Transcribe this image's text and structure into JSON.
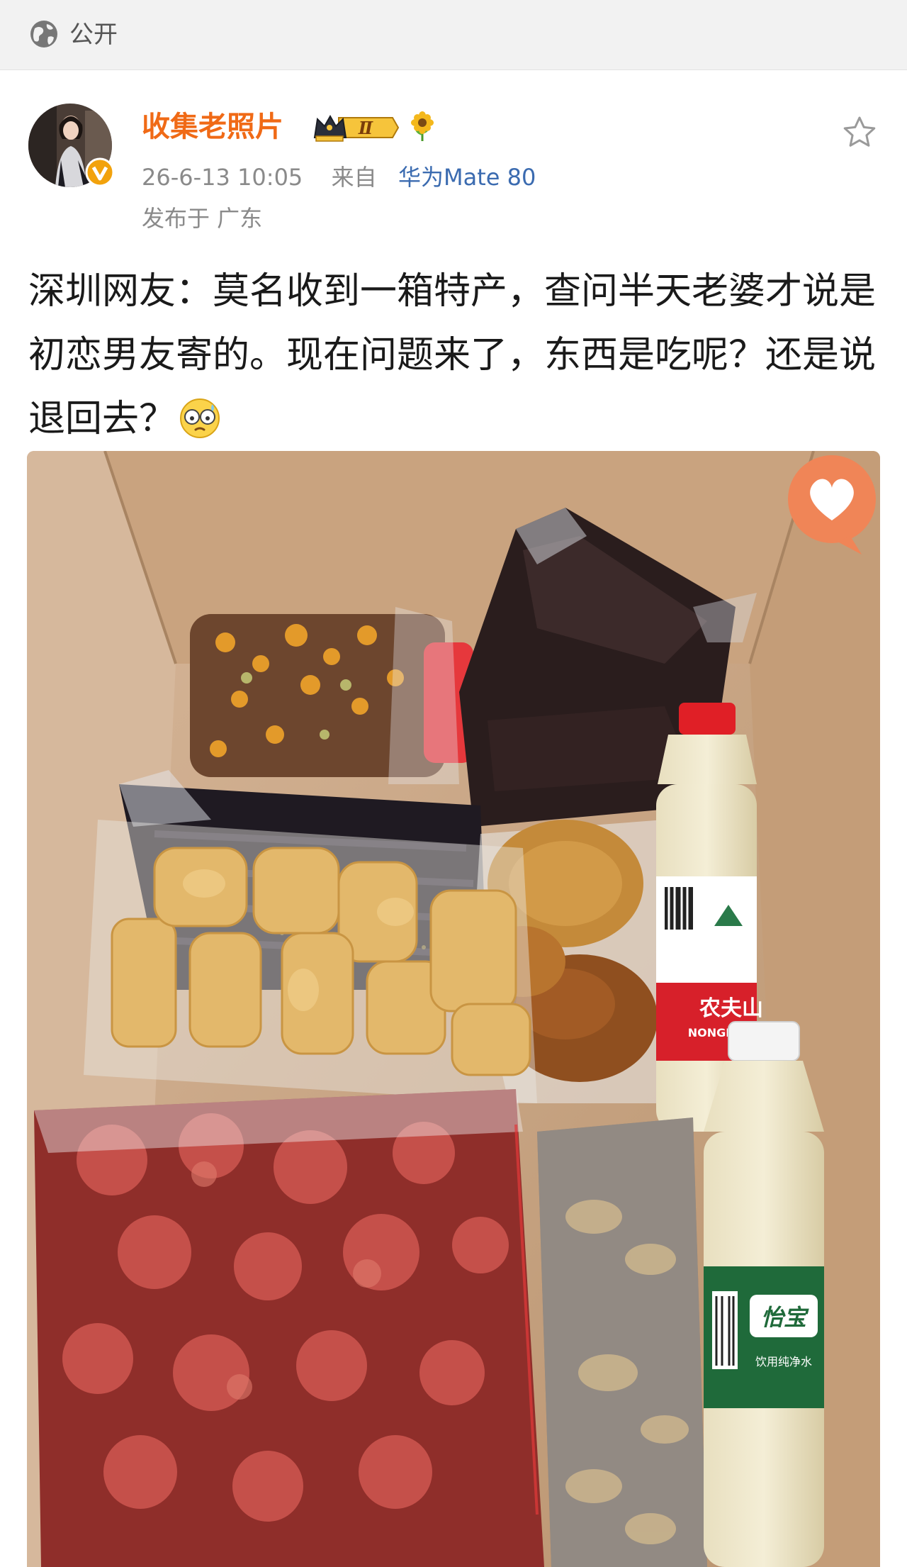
{
  "visibility": {
    "icon": "globe-icon",
    "label": "公开"
  },
  "author": {
    "name": "收集老照片",
    "avatar_icon": "avatar-photo",
    "verified_icon": "verified-v-icon",
    "level_badge": "Ⅱ",
    "level_icon": "crown-level-icon",
    "medal_icon": "sunflower-icon"
  },
  "meta": {
    "timestamp": "26-6-13 10:05",
    "source_prefix": "来自",
    "device": "华为Mate 80",
    "location": "发布于 广东"
  },
  "post": {
    "text": "深圳网友：莫名收到一箱特产，查问半天老婆才说是初恋男友寄的。现在问题来了，东西是吃呢？还是说退回去？",
    "emoji_icon": "nervous-face-emoji"
  },
  "photo": {
    "alt_icon": "box-of-food-photo",
    "bottle1_brand": "农夫山",
    "bottle1_sub": "NONGFU S",
    "bottle2_brand": "怡宝",
    "bottle2_sub": "饮用纯净水"
  },
  "actions": {
    "favorite_icon": "star-outline-icon",
    "like_icon": "heart-bubble-icon"
  },
  "colors": {
    "accent_orange": "#f06a16",
    "link_blue": "#3b6bb0",
    "meta_gray": "#8a8a8a"
  }
}
